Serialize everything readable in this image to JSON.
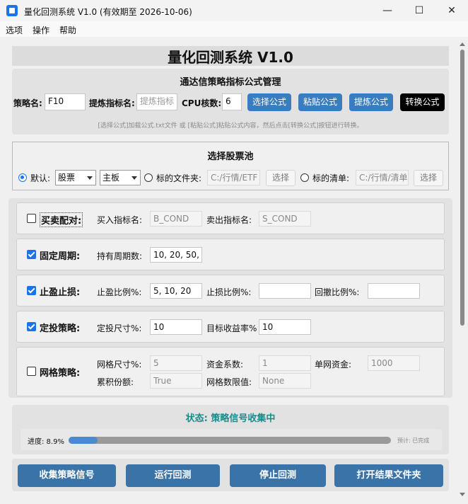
{
  "window": {
    "title": "量化回测系统 V1.0  (有效期至 2026-10-06)",
    "minimize_glyph": "—",
    "maximize_glyph": "☐",
    "close_glyph": "✕"
  },
  "menu": {
    "items": [
      "选项",
      "操作",
      "帮助"
    ]
  },
  "header": {
    "title": "量化回测系统 V1.0"
  },
  "formula": {
    "title": "通达信策略指标公式管理",
    "strategy_label": "策略名:",
    "strategy_value": "F10",
    "extract_label": "提炼指标名:",
    "extract_placeholder": "提炼指标",
    "cpu_label": "CPU核数:",
    "cpu_value": "6",
    "btn_select": "选择公式",
    "btn_paste": "粘贴公式",
    "btn_extract": "提炼公式",
    "btn_convert": "转换公式",
    "hint": "[选择公式]加载公式.txt文件 或 [粘贴公式]粘贴公式内容，然后点击[转换公式]按钮进行转换。"
  },
  "pool": {
    "title": "选择股票池",
    "default_label": "默认:",
    "type_value": "股票",
    "board_value": "主板",
    "folder_label": "标的文件夹:",
    "folder_value": "C:/行情/ETF",
    "folder_btn": "选择",
    "list_label": "标的清单:",
    "list_value": "C:/行情/清单",
    "list_btn": "选择"
  },
  "strategies": {
    "pair": {
      "name": "买卖配对:",
      "checked": false,
      "buy_label": "买入指标名:",
      "buy_value": "B_COND",
      "sell_label": "卖出指标名:",
      "sell_value": "S_COND"
    },
    "fixed": {
      "name": "固定周期:",
      "checked": true,
      "hold_label": "持有周期数:",
      "hold_value": "10, 20, 50, 1"
    },
    "stop": {
      "name": "止盈止损:",
      "checked": true,
      "tp_label": "止盈比例%:",
      "tp_value": "5, 10, 20",
      "sl_label": "止损比例%:",
      "sl_value": "",
      "dd_label": "回撤比例%:",
      "dd_value": ""
    },
    "invest": {
      "name": "定投策略:",
      "checked": true,
      "size_label": "定投尺寸%:",
      "size_value": "10",
      "target_label": "目标收益率%",
      "target_value": "10"
    },
    "grid": {
      "name": "网格策略:",
      "checked": false,
      "size_label": "网格尺寸%:",
      "size_value": "5",
      "coef_label": "资金系数:",
      "coef_value": "1",
      "single_label": "单网资金:",
      "single_value": "1000",
      "accum_label": "累积份额:",
      "accum_value": "True",
      "limit_label": "网格数限值:",
      "limit_value": "None"
    }
  },
  "status": {
    "text": "状态: 策略信号收集中",
    "progress_label": "进度: 8.9%",
    "progress": 0.089,
    "eta": "预计: 已完成"
  },
  "actions": {
    "collect": "收集策略信号",
    "run": "运行回测",
    "stop": "停止回测",
    "open": "打开结果文件夹"
  },
  "colors": {
    "accent": "#3a7cc0",
    "status_text": "#1a8a8a",
    "progress_fill": "#4a8ad0"
  }
}
